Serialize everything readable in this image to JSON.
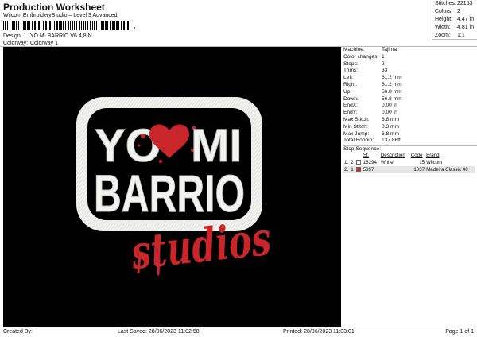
{
  "header": {
    "title": "Production Worksheet",
    "subtitle": "Wilcom EmbroideryStudio – Level 3 Advanced",
    "barcode_suffix": ",",
    "design_label": "Design:",
    "design_value": "YO MI BARRIO V6 4,8IN",
    "colorway_label": "Colorway:",
    "colorway_value": "Colorway 1"
  },
  "summary": [
    {
      "label": "Stitches:",
      "value": "22153"
    },
    {
      "label": "Colors:",
      "value": "2"
    },
    {
      "label": "Height:",
      "value": "4.47 in"
    },
    {
      "label": "Width:",
      "value": "4.81 in"
    },
    {
      "label": "Zoom:",
      "value": "1:1"
    }
  ],
  "design_preview": {
    "line1_left": "YO",
    "line1_right": "MI",
    "line2": "BARRIO",
    "script": "studios",
    "thread_color_1": "#f2f2f0",
    "thread_color_2": "#c8262b"
  },
  "machine_info": [
    {
      "label": "Machine:",
      "value": "Tajima"
    },
    {
      "label": "Color changes:",
      "value": "1"
    },
    {
      "label": "Stops:",
      "value": "2"
    },
    {
      "label": "Trims:",
      "value": "33"
    },
    {
      "label": "Left:",
      "value": "61.2 mm"
    },
    {
      "label": "Right:",
      "value": "61.2 mm"
    },
    {
      "label": "Up:",
      "value": "56.8 mm"
    },
    {
      "label": "Down:",
      "value": "56.8 mm"
    },
    {
      "label": "EndX:",
      "value": "0.00 in"
    },
    {
      "label": "EndY:",
      "value": "0.00 in"
    },
    {
      "label": "Max Stitch:",
      "value": "6.8 mm"
    },
    {
      "label": "Min Stitch:",
      "value": "0.3 mm"
    },
    {
      "label": "Max Jump:",
      "value": "6.8 mm"
    },
    {
      "label": "Total Bobbin:",
      "value": "137.86ft"
    }
  ],
  "stop_sequence": {
    "label": "Stop Sequence:",
    "columns": {
      "st": "St.",
      "description": "Description",
      "code": "Code",
      "brand": "Brand"
    },
    "rows": [
      {
        "num": "1.",
        "stop": "2",
        "color": "#ffffff",
        "stitches": "16294",
        "description": "White",
        "code": "15",
        "brand": "Wilcom"
      },
      {
        "num": "2.",
        "stop": "1",
        "color": "#c8262b",
        "stitches": "5857",
        "description": "",
        "code": "1037",
        "brand": "Madeira Classic 40"
      }
    ]
  },
  "footer": {
    "created_by": "Created By:",
    "last_saved": "Last Saved: 28/06/2023 11:02:58",
    "printed": "Printed: 28/06/2023 11:03:01",
    "page": "Page 1 of 1"
  }
}
